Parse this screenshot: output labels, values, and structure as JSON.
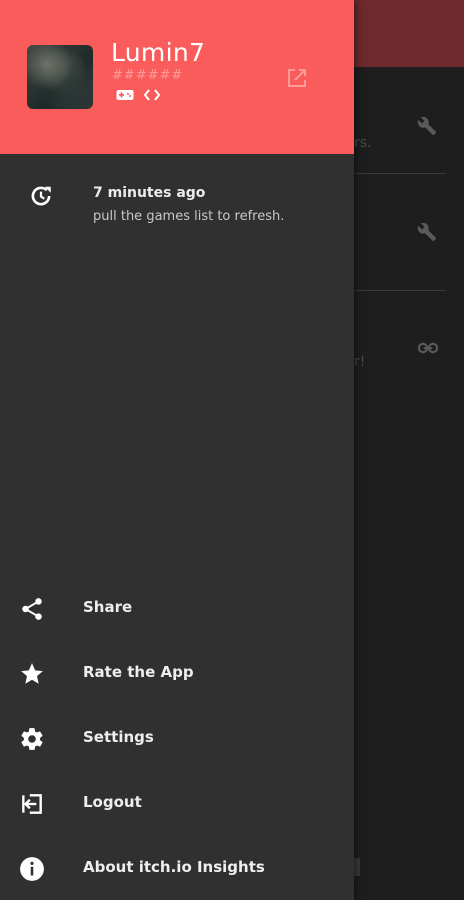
{
  "background": {
    "appbar_color": "#6e2a2c",
    "fragments": [
      "rs.",
      "r!"
    ]
  },
  "drawer": {
    "header": {
      "color": "#fa5c5c",
      "username": "Lumin7",
      "masked_text": "######",
      "icons": [
        "gamepad-icon",
        "code-icon"
      ],
      "external_icon": "open-external-icon"
    },
    "refresh": {
      "icon": "refresh-history-icon",
      "title": "7 minutes ago",
      "subtitle": "pull the games list to refresh."
    },
    "menu": [
      {
        "id": "share",
        "icon": "share-icon",
        "label": "Share"
      },
      {
        "id": "rate",
        "icon": "star-icon",
        "label": "Rate the App"
      },
      {
        "id": "settings",
        "icon": "gear-icon",
        "label": "Settings"
      },
      {
        "id": "logout",
        "icon": "logout-icon",
        "label": "Logout"
      },
      {
        "id": "about",
        "icon": "info-icon",
        "label": "About itch.io Insights"
      }
    ]
  }
}
